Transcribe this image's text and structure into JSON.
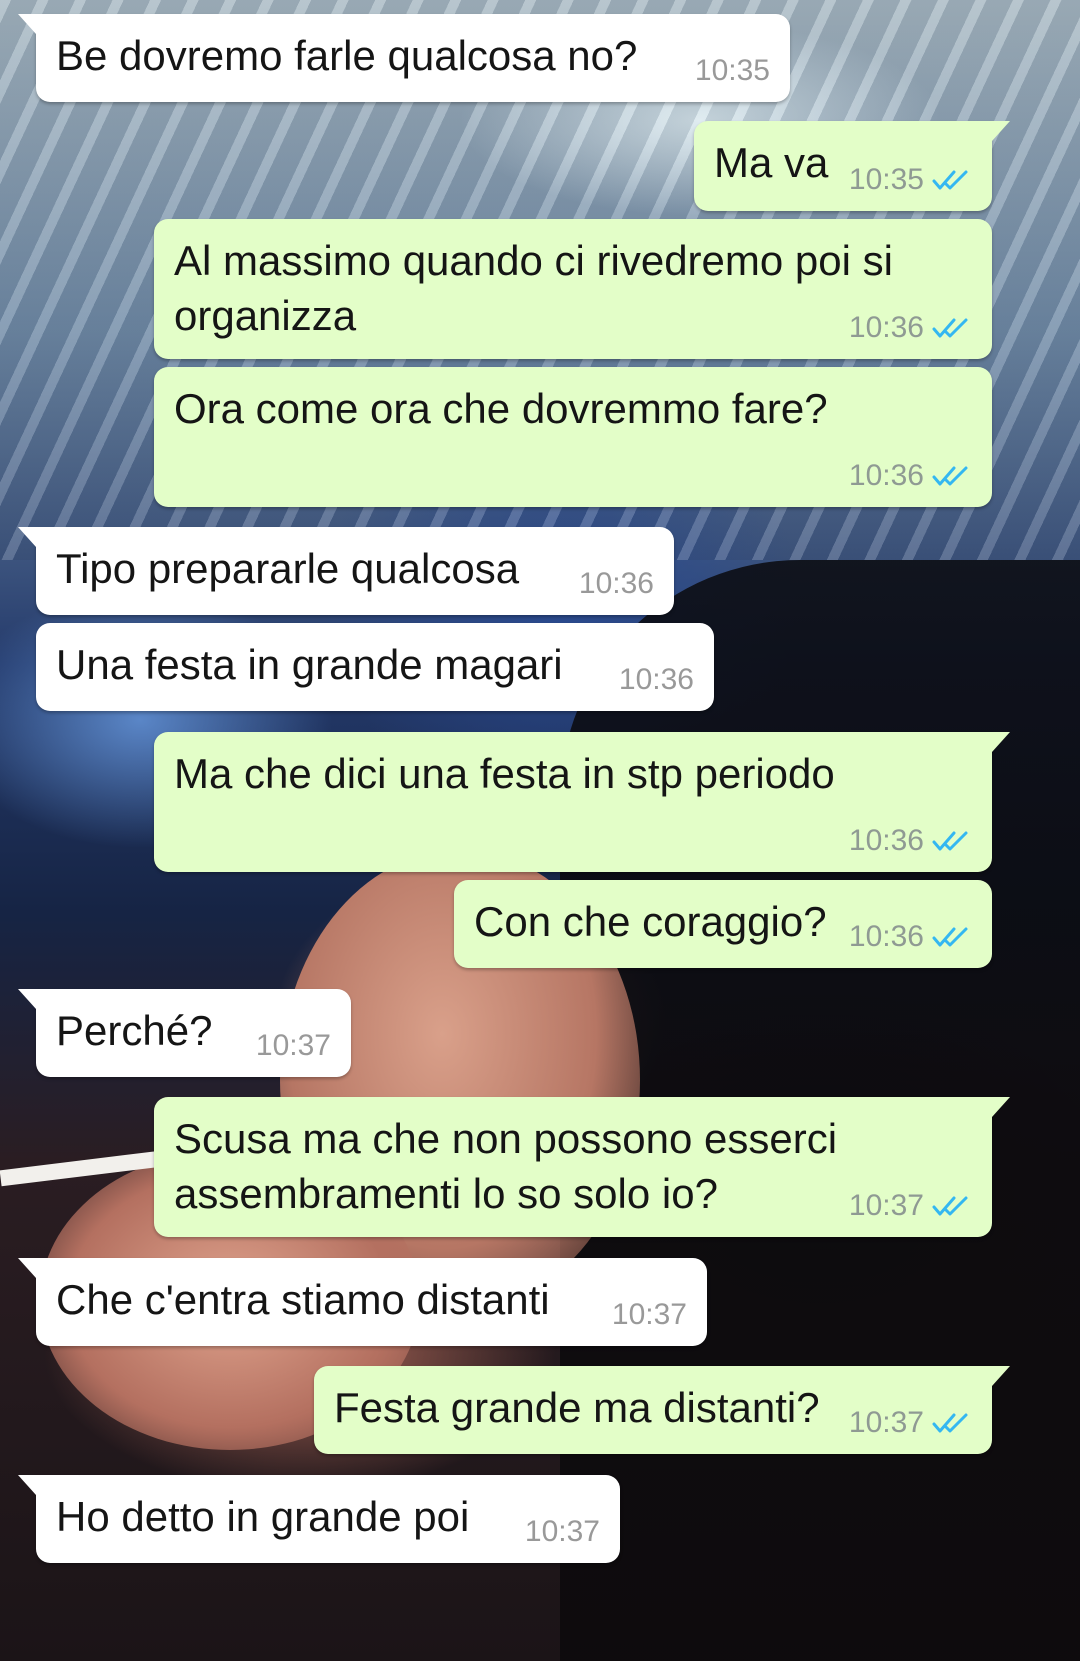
{
  "chat": {
    "theme": {
      "incoming_bubble": "#ffffff",
      "outgoing_bubble": "#e3fec8",
      "read_tick_color": "#34b7f1"
    },
    "messages": [
      {
        "direction": "incoming",
        "text": "Be dovremo farle qualcosa no?",
        "time": "10:35"
      },
      {
        "direction": "outgoing",
        "text": "Ma va",
        "time": "10:35",
        "status": "read-double-check-icon"
      },
      {
        "direction": "outgoing",
        "text": "Al massimo quando ci rivedremo poi si\norganizza",
        "time": "10:36",
        "status": "read-double-check-icon"
      },
      {
        "direction": "outgoing",
        "text": "Ora come ora che dovremmo fare?",
        "time": "10:36",
        "status": "read-double-check-icon"
      },
      {
        "direction": "incoming",
        "text": "Tipo prepararle qualcosa",
        "time": "10:36"
      },
      {
        "direction": "incoming",
        "text": "Una festa in grande magari",
        "time": "10:36"
      },
      {
        "direction": "outgoing",
        "text": "Ma che dici una festa in stp periodo",
        "time": "10:36",
        "status": "read-double-check-icon"
      },
      {
        "direction": "outgoing",
        "text": "Con che coraggio?",
        "time": "10:36",
        "status": "read-double-check-icon"
      },
      {
        "direction": "incoming",
        "text": "Perché?",
        "time": "10:37"
      },
      {
        "direction": "outgoing",
        "text": "Scusa ma che non possono esserci\nassembramenti lo so solo io?",
        "time": "10:37",
        "status": "read-double-check-icon"
      },
      {
        "direction": "incoming",
        "text": "Che c'entra stiamo distanti",
        "time": "10:37"
      },
      {
        "direction": "outgoing",
        "text": "Festa grande ma distanti?",
        "time": "10:37",
        "status": "read-double-check-icon"
      },
      {
        "direction": "incoming",
        "text": "Ho detto in grande poi",
        "time": "10:37"
      }
    ]
  }
}
